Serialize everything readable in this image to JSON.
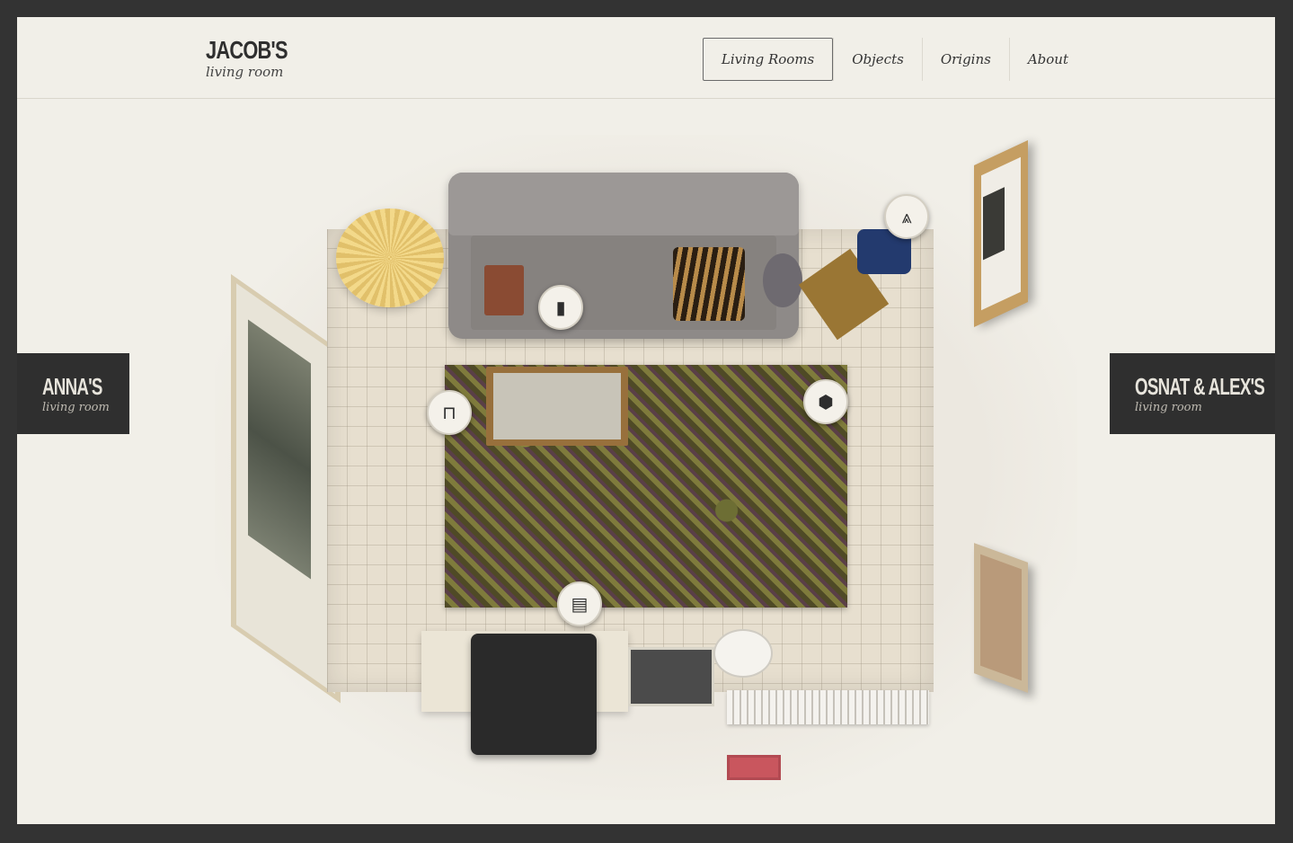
{
  "header": {
    "brand_name": "JACOB'S",
    "brand_sub": "living room",
    "nav": [
      {
        "label": "Living Rooms",
        "active": true
      },
      {
        "label": "Objects",
        "active": false
      },
      {
        "label": "Origins",
        "active": false
      },
      {
        "label": "About",
        "active": false
      }
    ]
  },
  "side_links": {
    "left": {
      "title": "ANNA'S",
      "sub": "living room"
    },
    "right": {
      "title": "OSNAT & ALEX'S",
      "sub": "living room"
    }
  },
  "hotspots": [
    {
      "name": "book-hotspot",
      "icon": "notebook-icon",
      "glyph": "▮"
    },
    {
      "name": "jeans-hotspot",
      "icon": "jeans-icon",
      "glyph": "⩓"
    },
    {
      "name": "table-hotspot",
      "icon": "table-icon",
      "glyph": "⊓"
    },
    {
      "name": "box-hotspot",
      "icon": "box-icon",
      "glyph": "⬢"
    },
    {
      "name": "cabinet-hotspot",
      "icon": "cabinet-icon",
      "glyph": "▤"
    }
  ],
  "colors": {
    "background": "#f1efe8",
    "outer_frame": "#333333",
    "side_panel": "#2f2f2f"
  }
}
